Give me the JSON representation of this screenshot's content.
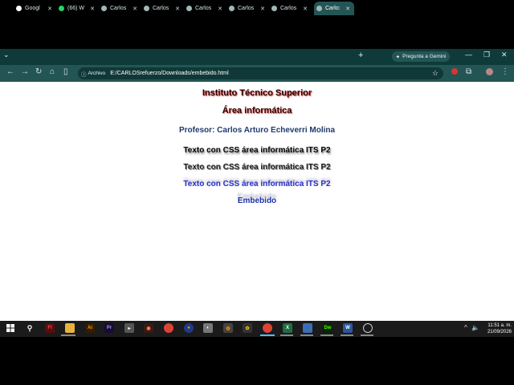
{
  "browser": {
    "tabs": [
      {
        "label": "Googl",
        "active": false
      },
      {
        "label": "(66) W",
        "active": false
      },
      {
        "label": "Carlos",
        "active": false
      },
      {
        "label": "Carlos",
        "active": false
      },
      {
        "label": "Carlos",
        "active": false
      },
      {
        "label": "Carlos",
        "active": false
      },
      {
        "label": "Carlos",
        "active": false
      },
      {
        "label": "Carlo:",
        "active": true
      }
    ],
    "gemini_label": "Pregunta a Gemini",
    "address": {
      "chip_label": "Archivo",
      "url": "E:/CARLOSrefuerzo/Downloads/embebido.html"
    }
  },
  "page": {
    "line1": "Instituto Técnico Superior",
    "line2": "Área informática",
    "line3": "Profesor: Carlos Arturo Echeverri Molina",
    "line4": "Texto con CSS área informática ITS P2",
    "line5": "Texto con CSS área informática ITS P2",
    "line6": "Texto con CSS área informática ITS P2",
    "line7": "Embebido"
  },
  "taskbar": {
    "time": "11:51 a. m.",
    "date": "21/09/2026",
    "colors": {
      "accent": "#4cc2ff"
    }
  }
}
